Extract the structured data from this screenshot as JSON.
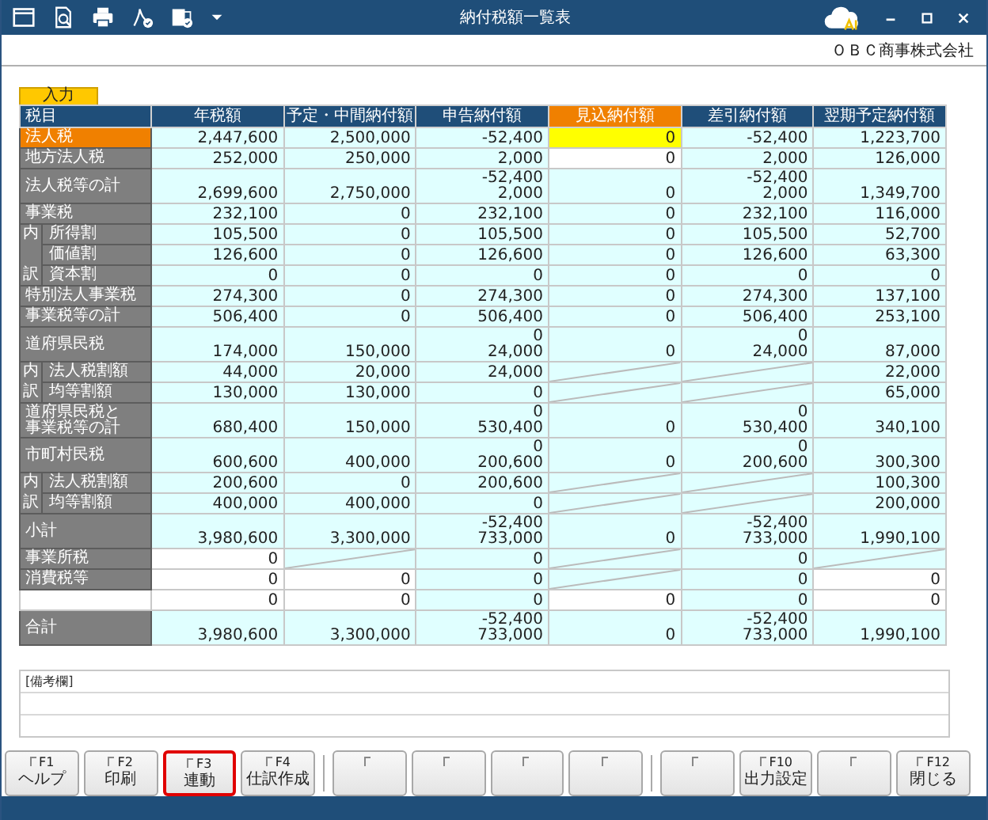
{
  "window": {
    "title": "納付税額一覧表"
  },
  "company": "ＯＢＣ商事株式会社",
  "input_tab": {
    "label": "入力"
  },
  "headers": [
    {
      "label": "税目",
      "selected": false
    },
    {
      "label": "年税額",
      "selected": false
    },
    {
      "label": "予定・中間納付額",
      "selected": false
    },
    {
      "label": "申告納付額",
      "selected": false
    },
    {
      "label": "見込納付額",
      "selected": true
    },
    {
      "label": "差引納付額",
      "selected": false
    },
    {
      "label": "翌期予定納付額",
      "selected": false
    }
  ],
  "rows": [
    {
      "kind": "main",
      "label": "法人税",
      "selected": true,
      "cells": [
        {
          "kind": "calc",
          "values": [
            "2,447,600"
          ],
          "selected": false
        },
        {
          "kind": "calc",
          "values": [
            "2,500,000"
          ],
          "selected": false
        },
        {
          "kind": "calc",
          "values": [
            "-52,400"
          ],
          "selected": false
        },
        {
          "kind": "input",
          "values": [
            "0"
          ],
          "selected": true
        },
        {
          "kind": "calc",
          "values": [
            "-52,400"
          ],
          "selected": false
        },
        {
          "kind": "calc",
          "values": [
            "1,223,700"
          ],
          "selected": false
        }
      ]
    },
    {
      "kind": "main",
      "label": "地方法人税",
      "selected": false,
      "cells": [
        {
          "kind": "calc",
          "values": [
            "252,000"
          ],
          "selected": false
        },
        {
          "kind": "calc",
          "values": [
            "250,000"
          ],
          "selected": false
        },
        {
          "kind": "calc",
          "values": [
            "2,000"
          ],
          "selected": false
        },
        {
          "kind": "input",
          "values": [
            "0"
          ],
          "selected": false
        },
        {
          "kind": "calc",
          "values": [
            "2,000"
          ],
          "selected": false
        },
        {
          "kind": "calc",
          "values": [
            "126,000"
          ],
          "selected": false
        }
      ]
    },
    {
      "kind": "main",
      "label": "法人税等の計",
      "selected": false,
      "cells": [
        {
          "kind": "calc",
          "values": [
            "2,699,600"
          ],
          "selected": false
        },
        {
          "kind": "calc",
          "values": [
            "2,750,000"
          ],
          "selected": false
        },
        {
          "kind": "calc",
          "values": [
            "-52,400",
            "2,000"
          ],
          "selected": false
        },
        {
          "kind": "calc",
          "values": [
            "0"
          ],
          "selected": false
        },
        {
          "kind": "calc",
          "values": [
            "-52,400",
            "2,000"
          ],
          "selected": false
        },
        {
          "kind": "calc",
          "values": [
            "1,349,700"
          ],
          "selected": false
        }
      ]
    },
    {
      "kind": "main",
      "label": "事業税",
      "selected": false,
      "cells": [
        {
          "kind": "calc",
          "values": [
            "232,100"
          ],
          "selected": false
        },
        {
          "kind": "calc",
          "values": [
            "0"
          ],
          "selected": false
        },
        {
          "kind": "calc",
          "values": [
            "232,100"
          ],
          "selected": false
        },
        {
          "kind": "calc",
          "values": [
            "0"
          ],
          "selected": false
        },
        {
          "kind": "calc",
          "values": [
            "232,100"
          ],
          "selected": false
        },
        {
          "kind": "calc",
          "values": [
            "116,000"
          ],
          "selected": false
        }
      ]
    },
    {
      "kind": "sub",
      "mark": "内",
      "label": "所得割",
      "selected": false,
      "cells": [
        {
          "kind": "calc",
          "values": [
            "105,500"
          ],
          "selected": false
        },
        {
          "kind": "calc",
          "values": [
            "0"
          ],
          "selected": false
        },
        {
          "kind": "calc",
          "values": [
            "105,500"
          ],
          "selected": false
        },
        {
          "kind": "calc",
          "values": [
            "0"
          ],
          "selected": false
        },
        {
          "kind": "calc",
          "values": [
            "105,500"
          ],
          "selected": false
        },
        {
          "kind": "calc",
          "values": [
            "52,700"
          ],
          "selected": false
        }
      ]
    },
    {
      "kind": "sub",
      "label": "価値割",
      "selected": false,
      "cells": [
        {
          "kind": "calc",
          "values": [
            "126,600"
          ],
          "selected": false
        },
        {
          "kind": "calc",
          "values": [
            "0"
          ],
          "selected": false
        },
        {
          "kind": "calc",
          "values": [
            "126,600"
          ],
          "selected": false
        },
        {
          "kind": "calc",
          "values": [
            "0"
          ],
          "selected": false
        },
        {
          "kind": "calc",
          "values": [
            "126,600"
          ],
          "selected": false
        },
        {
          "kind": "calc",
          "values": [
            "63,300"
          ],
          "selected": false
        }
      ]
    },
    {
      "kind": "sub",
      "mark": "訳",
      "label": "資本割",
      "selected": false,
      "cells": [
        {
          "kind": "calc",
          "values": [
            "0"
          ],
          "selected": false
        },
        {
          "kind": "calc",
          "values": [
            "0"
          ],
          "selected": false
        },
        {
          "kind": "calc",
          "values": [
            "0"
          ],
          "selected": false
        },
        {
          "kind": "calc",
          "values": [
            "0"
          ],
          "selected": false
        },
        {
          "kind": "calc",
          "values": [
            "0"
          ],
          "selected": false
        },
        {
          "kind": "calc",
          "values": [
            "0"
          ],
          "selected": false
        }
      ]
    },
    {
      "kind": "main",
      "label": "特別法人事業税",
      "selected": false,
      "cells": [
        {
          "kind": "calc",
          "values": [
            "274,300"
          ],
          "selected": false
        },
        {
          "kind": "calc",
          "values": [
            "0"
          ],
          "selected": false
        },
        {
          "kind": "calc",
          "values": [
            "274,300"
          ],
          "selected": false
        },
        {
          "kind": "calc",
          "values": [
            "0"
          ],
          "selected": false
        },
        {
          "kind": "calc",
          "values": [
            "274,300"
          ],
          "selected": false
        },
        {
          "kind": "calc",
          "values": [
            "137,100"
          ],
          "selected": false
        }
      ]
    },
    {
      "kind": "main",
      "label": "事業税等の計",
      "selected": false,
      "cells": [
        {
          "kind": "calc",
          "values": [
            "506,400"
          ],
          "selected": false
        },
        {
          "kind": "calc",
          "values": [
            "0"
          ],
          "selected": false
        },
        {
          "kind": "calc",
          "values": [
            "506,400"
          ],
          "selected": false
        },
        {
          "kind": "calc",
          "values": [
            "0"
          ],
          "selected": false
        },
        {
          "kind": "calc",
          "values": [
            "506,400"
          ],
          "selected": false
        },
        {
          "kind": "calc",
          "values": [
            "253,100"
          ],
          "selected": false
        }
      ]
    },
    {
      "kind": "main",
      "label": "道府県民税",
      "selected": false,
      "cells": [
        {
          "kind": "calc",
          "values": [
            "174,000"
          ],
          "selected": false
        },
        {
          "kind": "calc",
          "values": [
            "150,000"
          ],
          "selected": false
        },
        {
          "kind": "calc",
          "values": [
            "0",
            "24,000"
          ],
          "selected": false
        },
        {
          "kind": "calc",
          "values": [
            "0"
          ],
          "selected": false
        },
        {
          "kind": "calc",
          "values": [
            "0",
            "24,000"
          ],
          "selected": false
        },
        {
          "kind": "calc",
          "values": [
            "87,000"
          ],
          "selected": false
        }
      ]
    },
    {
      "kind": "sub",
      "mark": "内",
      "label": "法人税割額",
      "selected": false,
      "cells": [
        {
          "kind": "calc",
          "values": [
            "44,000"
          ],
          "selected": false
        },
        {
          "kind": "calc",
          "values": [
            "20,000"
          ],
          "selected": false
        },
        {
          "kind": "calc",
          "values": [
            "24,000"
          ],
          "selected": false
        },
        {
          "kind": "slash",
          "selected": false
        },
        {
          "kind": "slash",
          "selected": false
        },
        {
          "kind": "calc",
          "values": [
            "22,000"
          ],
          "selected": false
        }
      ]
    },
    {
      "kind": "sub",
      "mark": "訳",
      "label": "均等割額",
      "selected": false,
      "cells": [
        {
          "kind": "calc",
          "values": [
            "130,000"
          ],
          "selected": false
        },
        {
          "kind": "calc",
          "values": [
            "130,000"
          ],
          "selected": false
        },
        {
          "kind": "calc",
          "values": [
            "0"
          ],
          "selected": false
        },
        {
          "kind": "slash",
          "selected": false
        },
        {
          "kind": "slash",
          "selected": false
        },
        {
          "kind": "calc",
          "values": [
            "65,000"
          ],
          "selected": false
        }
      ]
    },
    {
      "kind": "main",
      "label_lines": [
        "道府県民税と",
        "事業税等の計"
      ],
      "selected": false,
      "cells": [
        {
          "kind": "calc",
          "values": [
            "680,400"
          ],
          "selected": false
        },
        {
          "kind": "calc",
          "values": [
            "150,000"
          ],
          "selected": false
        },
        {
          "kind": "calc",
          "values": [
            "0",
            "530,400"
          ],
          "selected": false
        },
        {
          "kind": "calc",
          "values": [
            "0"
          ],
          "selected": false
        },
        {
          "kind": "calc",
          "values": [
            "0",
            "530,400"
          ],
          "selected": false
        },
        {
          "kind": "calc",
          "values": [
            "340,100"
          ],
          "selected": false
        }
      ]
    },
    {
      "kind": "main",
      "label": "市町村民税",
      "selected": false,
      "cells": [
        {
          "kind": "calc",
          "values": [
            "600,600"
          ],
          "selected": false
        },
        {
          "kind": "calc",
          "values": [
            "400,000"
          ],
          "selected": false
        },
        {
          "kind": "calc",
          "values": [
            "0",
            "200,600"
          ],
          "selected": false
        },
        {
          "kind": "calc",
          "values": [
            "0"
          ],
          "selected": false
        },
        {
          "kind": "calc",
          "values": [
            "0",
            "200,600"
          ],
          "selected": false
        },
        {
          "kind": "calc",
          "values": [
            "300,300"
          ],
          "selected": false
        }
      ]
    },
    {
      "kind": "sub",
      "mark": "内",
      "label": "法人税割額",
      "selected": false,
      "cells": [
        {
          "kind": "calc",
          "values": [
            "200,600"
          ],
          "selected": false
        },
        {
          "kind": "calc",
          "values": [
            "0"
          ],
          "selected": false
        },
        {
          "kind": "calc",
          "values": [
            "200,600"
          ],
          "selected": false
        },
        {
          "kind": "slash",
          "selected": false
        },
        {
          "kind": "slash",
          "selected": false
        },
        {
          "kind": "calc",
          "values": [
            "100,300"
          ],
          "selected": false
        }
      ]
    },
    {
      "kind": "sub",
      "mark": "訳",
      "label": "均等割額",
      "selected": false,
      "cells": [
        {
          "kind": "calc",
          "values": [
            "400,000"
          ],
          "selected": false
        },
        {
          "kind": "calc",
          "values": [
            "400,000"
          ],
          "selected": false
        },
        {
          "kind": "calc",
          "values": [
            "0"
          ],
          "selected": false
        },
        {
          "kind": "slash",
          "selected": false
        },
        {
          "kind": "slash",
          "selected": false
        },
        {
          "kind": "calc",
          "values": [
            "200,000"
          ],
          "selected": false
        }
      ]
    },
    {
      "kind": "main",
      "label": "小計",
      "selected": false,
      "cells": [
        {
          "kind": "calc",
          "values": [
            "3,980,600"
          ],
          "selected": false
        },
        {
          "kind": "calc",
          "values": [
            "3,300,000"
          ],
          "selected": false
        },
        {
          "kind": "calc",
          "values": [
            "-52,400",
            "733,000"
          ],
          "selected": false
        },
        {
          "kind": "calc",
          "values": [
            "0"
          ],
          "selected": false
        },
        {
          "kind": "calc",
          "values": [
            "-52,400",
            "733,000"
          ],
          "selected": false
        },
        {
          "kind": "calc",
          "values": [
            "1,990,100"
          ],
          "selected": false
        }
      ]
    },
    {
      "kind": "main",
      "label": "事業所税",
      "selected": false,
      "cells": [
        {
          "kind": "input",
          "values": [
            "0"
          ],
          "selected": false
        },
        {
          "kind": "slash",
          "selected": false
        },
        {
          "kind": "calc",
          "values": [
            "0"
          ],
          "selected": false
        },
        {
          "kind": "slash",
          "selected": false
        },
        {
          "kind": "calc",
          "values": [
            "0"
          ],
          "selected": false
        },
        {
          "kind": "slash",
          "selected": false
        }
      ]
    },
    {
      "kind": "main",
      "label": "消費税等",
      "selected": false,
      "cells": [
        {
          "kind": "input",
          "values": [
            "0"
          ],
          "selected": false
        },
        {
          "kind": "input",
          "values": [
            "0"
          ],
          "selected": false
        },
        {
          "kind": "calc",
          "values": [
            "0"
          ],
          "selected": false
        },
        {
          "kind": "slash",
          "selected": false
        },
        {
          "kind": "calc",
          "values": [
            "0"
          ],
          "selected": false
        },
        {
          "kind": "input",
          "values": [
            "0"
          ],
          "selected": false
        }
      ]
    },
    {
      "kind": "blank",
      "selected": false,
      "cells": [
        {
          "kind": "input",
          "values": [
            "0"
          ],
          "selected": false
        },
        {
          "kind": "input",
          "values": [
            "0"
          ],
          "selected": false
        },
        {
          "kind": "calc",
          "values": [
            "0"
          ],
          "selected": false
        },
        {
          "kind": "input",
          "values": [
            "0"
          ],
          "selected": false
        },
        {
          "kind": "calc",
          "values": [
            "0"
          ],
          "selected": false
        },
        {
          "kind": "input",
          "values": [
            "0"
          ],
          "selected": false
        }
      ]
    },
    {
      "kind": "main",
      "label": "合計",
      "selected": false,
      "cells": [
        {
          "kind": "calc",
          "values": [
            "3,980,600"
          ],
          "selected": false
        },
        {
          "kind": "calc",
          "values": [
            "3,300,000"
          ],
          "selected": false
        },
        {
          "kind": "calc",
          "values": [
            "-52,400",
            "733,000"
          ],
          "selected": false
        },
        {
          "kind": "calc",
          "values": [
            "0"
          ],
          "selected": false
        },
        {
          "kind": "calc",
          "values": [
            "-52,400",
            "733,000"
          ],
          "selected": false
        },
        {
          "kind": "calc",
          "values": [
            "1,990,100"
          ],
          "selected": false
        }
      ]
    }
  ],
  "remarks": {
    "label": "[備考欄]"
  },
  "function_key_groups": [
    [
      {
        "key": "F1",
        "label": "ヘルプ",
        "highlighted": false
      },
      {
        "key": "F2",
        "label": "印刷",
        "highlighted": false
      },
      {
        "key": "F3",
        "label": "連動",
        "highlighted": true
      },
      {
        "key": "F4",
        "label": "仕訳作成",
        "highlighted": false
      }
    ],
    [
      {
        "highlighted": false
      },
      {
        "highlighted": false
      },
      {
        "highlighted": false
      },
      {
        "highlighted": false
      }
    ],
    [
      {
        "highlighted": false
      },
      {
        "key": "F10",
        "label": "出力設定",
        "highlighted": false
      },
      {
        "highlighted": false
      },
      {
        "key": "F12",
        "label": "閉じる",
        "highlighted": false
      }
    ]
  ]
}
